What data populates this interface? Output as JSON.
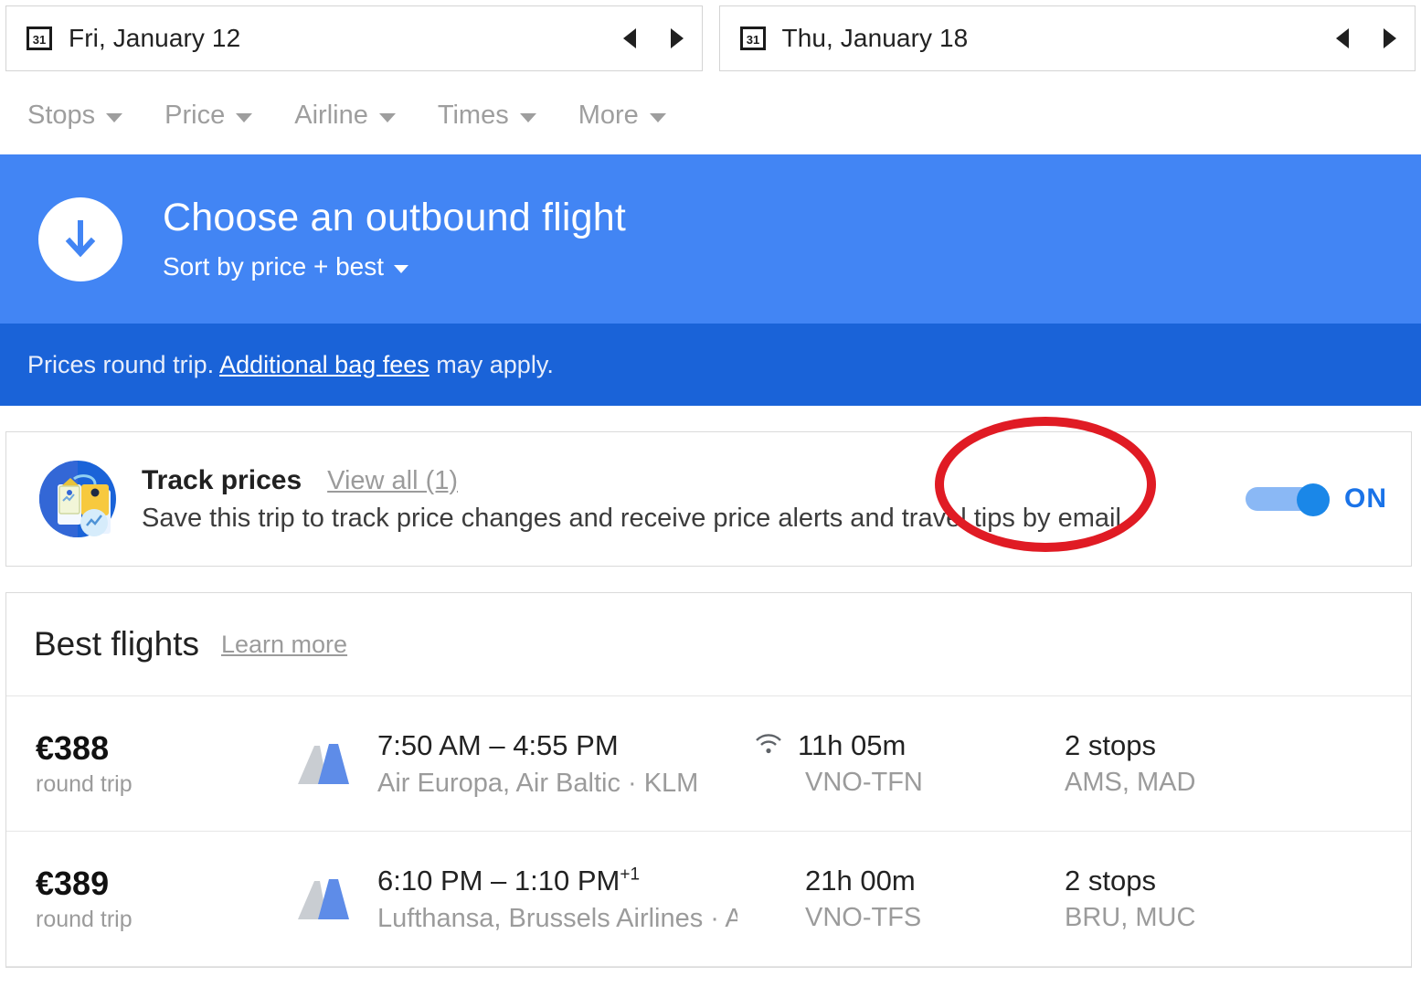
{
  "dates": {
    "depart": {
      "label": "Fri, January 12",
      "icon": "calendar-icon",
      "prev": "previous-day",
      "next": "next-day"
    },
    "return": {
      "label": "Thu, January 18",
      "icon": "calendar-icon",
      "prev": "previous-day",
      "next": "next-day"
    },
    "calendar_day_number": "31"
  },
  "filters": [
    {
      "label": "Stops"
    },
    {
      "label": "Price"
    },
    {
      "label": "Airline"
    },
    {
      "label": "Times"
    },
    {
      "label": "More"
    }
  ],
  "banner": {
    "title": "Choose an outbound flight",
    "sort_label": "Sort by price + best",
    "icon": "down-arrow-icon",
    "background_color": "#4285f4",
    "notice_prefix": "Prices round trip. ",
    "notice_link": "Additional bag fees",
    "notice_suffix": " may apply.",
    "notice_background_color": "#1a63d8"
  },
  "track_prices": {
    "icon": "price-tags-icon",
    "title": "Track prices",
    "view_all": "View all (1)",
    "description": "Save this trip to track price changes and receive price alerts and travel tips by email.",
    "toggle_state": "ON",
    "toggle_on_color": "#1a87e8",
    "annotation_color": "#e01b24"
  },
  "best_flights": {
    "title": "Best flights",
    "learn_more": "Learn more",
    "rows": [
      {
        "price": "€388",
        "price_note": "round trip",
        "logo": "airline-tail-icon",
        "times": "7:50 AM – 4:55 PM",
        "times_suffix": "",
        "airlines": "Air Europa, Air Baltic · KLM",
        "wifi": true,
        "duration": "11h 05m",
        "route": "VNO-TFN",
        "stops": "2 stops",
        "layovers": "AMS, MAD"
      },
      {
        "price": "€389",
        "price_note": "round trip",
        "logo": "airline-tail-icon",
        "times": "6:10 PM – 1:10 PM",
        "times_suffix": "+1",
        "airlines": "Lufthansa, Brussels Airlines · Air Baltic",
        "wifi": false,
        "duration": "21h 00m",
        "route": "VNO-TFS",
        "stops": "2 stops",
        "layovers": "BRU, MUC"
      }
    ]
  }
}
